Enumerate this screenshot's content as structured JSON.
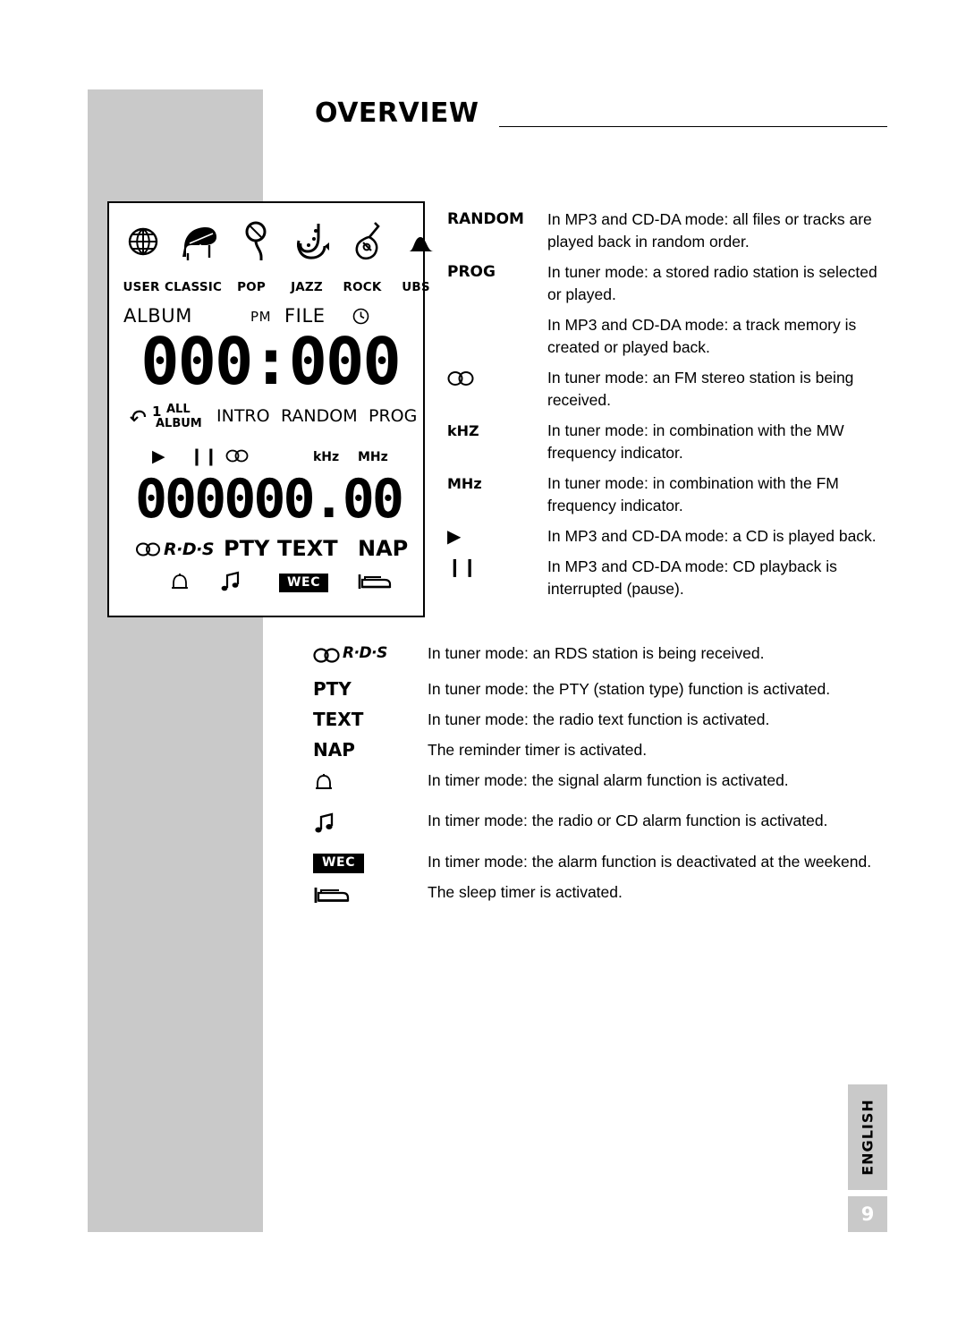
{
  "header": {
    "title": "OVERVIEW"
  },
  "display_panel": {
    "genre_icons": [
      {
        "name": "user-icon",
        "label": "USER"
      },
      {
        "name": "piano-icon",
        "label": "CLASSIC"
      },
      {
        "name": "microphone-icon",
        "label": "POP"
      },
      {
        "name": "saxophone-icon",
        "label": "JAZZ"
      },
      {
        "name": "guitar-icon",
        "label": "ROCK"
      },
      {
        "name": "bass-boost-icon",
        "label": "UBS"
      }
    ],
    "row_album": {
      "album": "ALBUM",
      "pm": "PM",
      "file": "FILE",
      "clock_icon": "clock-icon"
    },
    "digits_time": "000:000",
    "row_modes": {
      "repeat_icon": "repeat-icon",
      "one": "1",
      "all": "ALL",
      "album": "ALBUM",
      "intro": "INTRO",
      "random": "RANDOM",
      "prog": "PROG"
    },
    "row_transport": {
      "play": "▶",
      "pause": "❙❙",
      "stereo": "stereo-icon",
      "khz": "kHz",
      "mhz": "MHz"
    },
    "digits_freq": "000000.00",
    "row_rds": {
      "rds": "R·D·S",
      "pty": "PTY",
      "text": "TEXT",
      "nap": "NAP"
    },
    "row_timer": {
      "bell_icon": "bell-icon",
      "note_icon": "music-note-icon",
      "wec": "WEC",
      "bed_icon": "bed-icon"
    }
  },
  "descriptions_upper": [
    {
      "term": "RANDOM",
      "term_type": "text",
      "text": "In MP3 and CD-DA mode: all files or tracks are played back in random order."
    },
    {
      "term": "PROG",
      "term_type": "text",
      "text": "In tuner mode: a stored radio station is selected or played."
    },
    {
      "term": "",
      "term_type": "text",
      "text": "In MP3 and CD-DA mode: a track memory is created or played back."
    },
    {
      "term": "stereo-icon",
      "term_type": "stereo",
      "text": "In tuner mode: an FM stereo station is being received."
    },
    {
      "term": "kHZ",
      "term_type": "text",
      "text": "In tuner mode: in combination with the MW frequency indicator."
    },
    {
      "term": "MHz",
      "term_type": "text",
      "text": "In tuner mode: in combination with the FM frequency indicator."
    },
    {
      "term": "▶",
      "term_type": "symbol",
      "text": "In MP3 and CD-DA mode: a CD is played back."
    },
    {
      "term": "❙❙",
      "term_type": "symbol",
      "text": "In MP3 and CD-DA mode: CD playback is interrupted (pause)."
    }
  ],
  "descriptions_lower": [
    {
      "term": "R·D·S",
      "term_type": "rds",
      "text": "In tuner mode: an RDS station is being received."
    },
    {
      "term": "PTY",
      "term_type": "text",
      "text": "In tuner mode: the PTY (station type) function is activated."
    },
    {
      "term": "TEXT",
      "term_type": "text",
      "text": "In tuner mode: the radio text function is activated."
    },
    {
      "term": "NAP",
      "term_type": "text",
      "text": "The reminder timer is activated."
    },
    {
      "term": "bell-icon",
      "term_type": "bell",
      "text": "In timer mode: the signal alarm function is activated."
    },
    {
      "term": "music-note-icon",
      "term_type": "note",
      "text": "In timer mode: the radio or CD alarm function is activated."
    },
    {
      "term": "WEC",
      "term_type": "wec",
      "text": "In timer mode: the alarm function is deactivated at the weekend."
    },
    {
      "term": "bed-icon",
      "term_type": "bed",
      "text": "The sleep timer is activated."
    }
  ],
  "footer": {
    "language_tab": "ENGLISH",
    "page_number": "9"
  }
}
